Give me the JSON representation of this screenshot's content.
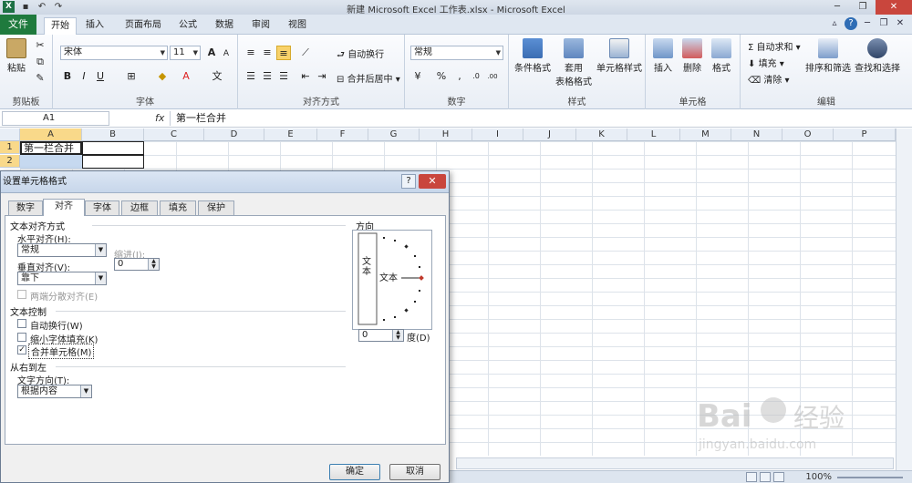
{
  "window": {
    "title": "新建 Microsoft Excel 工作表.xlsx - Microsoft Excel",
    "app_icon": "X"
  },
  "ribbon_tabs": {
    "file": "文件",
    "items": [
      "开始",
      "插入",
      "页面布局",
      "公式",
      "数据",
      "审阅",
      "视图"
    ],
    "active": "开始"
  },
  "ribbon": {
    "clipboard": {
      "label": "剪贴板",
      "paste": "粘贴"
    },
    "font": {
      "label": "字体",
      "name": "宋体",
      "size": "11",
      "grow": "A",
      "shrink": "A",
      "bold": "B",
      "italic": "I",
      "underline": "U",
      "fontcolor": "A",
      "wen": "文"
    },
    "alignment": {
      "label": "对齐方式",
      "wrap": "自动换行",
      "merge": "合并后居中"
    },
    "number": {
      "label": "数字",
      "format": "常规",
      "percent": "%",
      "comma": ",",
      "inc": ".0",
      "dec": ".00"
    },
    "styles": {
      "label": "样式",
      "cond": "条件格式",
      "table1": "套用",
      "table2": "表格格式",
      "cell": "单元格样式"
    },
    "cells": {
      "label": "单元格",
      "insert": "插入",
      "delete": "删除",
      "format": "格式"
    },
    "editing": {
      "label": "编辑",
      "sum": "自动求和",
      "fill": "填充",
      "clear": "清除",
      "sort": "排序和筛选",
      "find": "查找和选择"
    }
  },
  "formula_bar": {
    "name_box": "A1",
    "fx": "fx",
    "content": "第一栏合并"
  },
  "grid": {
    "columns": [
      "A",
      "B",
      "C",
      "D",
      "E",
      "F",
      "G",
      "H",
      "I",
      "J",
      "K",
      "L",
      "M",
      "N",
      "O",
      "P"
    ],
    "rows": [
      "1",
      "2"
    ],
    "a1": "第一栏合并"
  },
  "dialog": {
    "title": "设置单元格格式",
    "help": "?",
    "close": "✕",
    "tabs": [
      "数字",
      "对齐",
      "字体",
      "边框",
      "填充",
      "保护"
    ],
    "active_tab": "对齐",
    "text_align_section": "文本对齐方式",
    "h_align_label": "水平对齐(H):",
    "h_align_value": "常规",
    "indent_label": "缩进(I):",
    "indent_value": "0",
    "v_align_label": "垂直对齐(V):",
    "v_align_value": "靠下",
    "justify_distributed": "两端分散对齐(E)",
    "text_control_section": "文本控制",
    "wrap_text": "自动换行(W)",
    "shrink_to_fit": "缩小字体填充(K)",
    "merge_cells": "合并单元格(M)",
    "merge_checked": "✓",
    "rtl_section": "从右到左",
    "text_dir_label": "文字方向(T):",
    "text_dir_value": "根据内容",
    "orientation_label": "方向",
    "orient_vertical_text": "文本",
    "orient_text": "文本",
    "degrees_value": "0",
    "degrees_label": "度(D)",
    "ok": "确定",
    "cancel": "取消"
  },
  "status": {
    "zoom": "100%",
    "minus": "−",
    "plus": "+"
  },
  "watermark": {
    "brand": "Bai",
    "brand2": "经验",
    "url": "jingyan.baidu.com"
  }
}
